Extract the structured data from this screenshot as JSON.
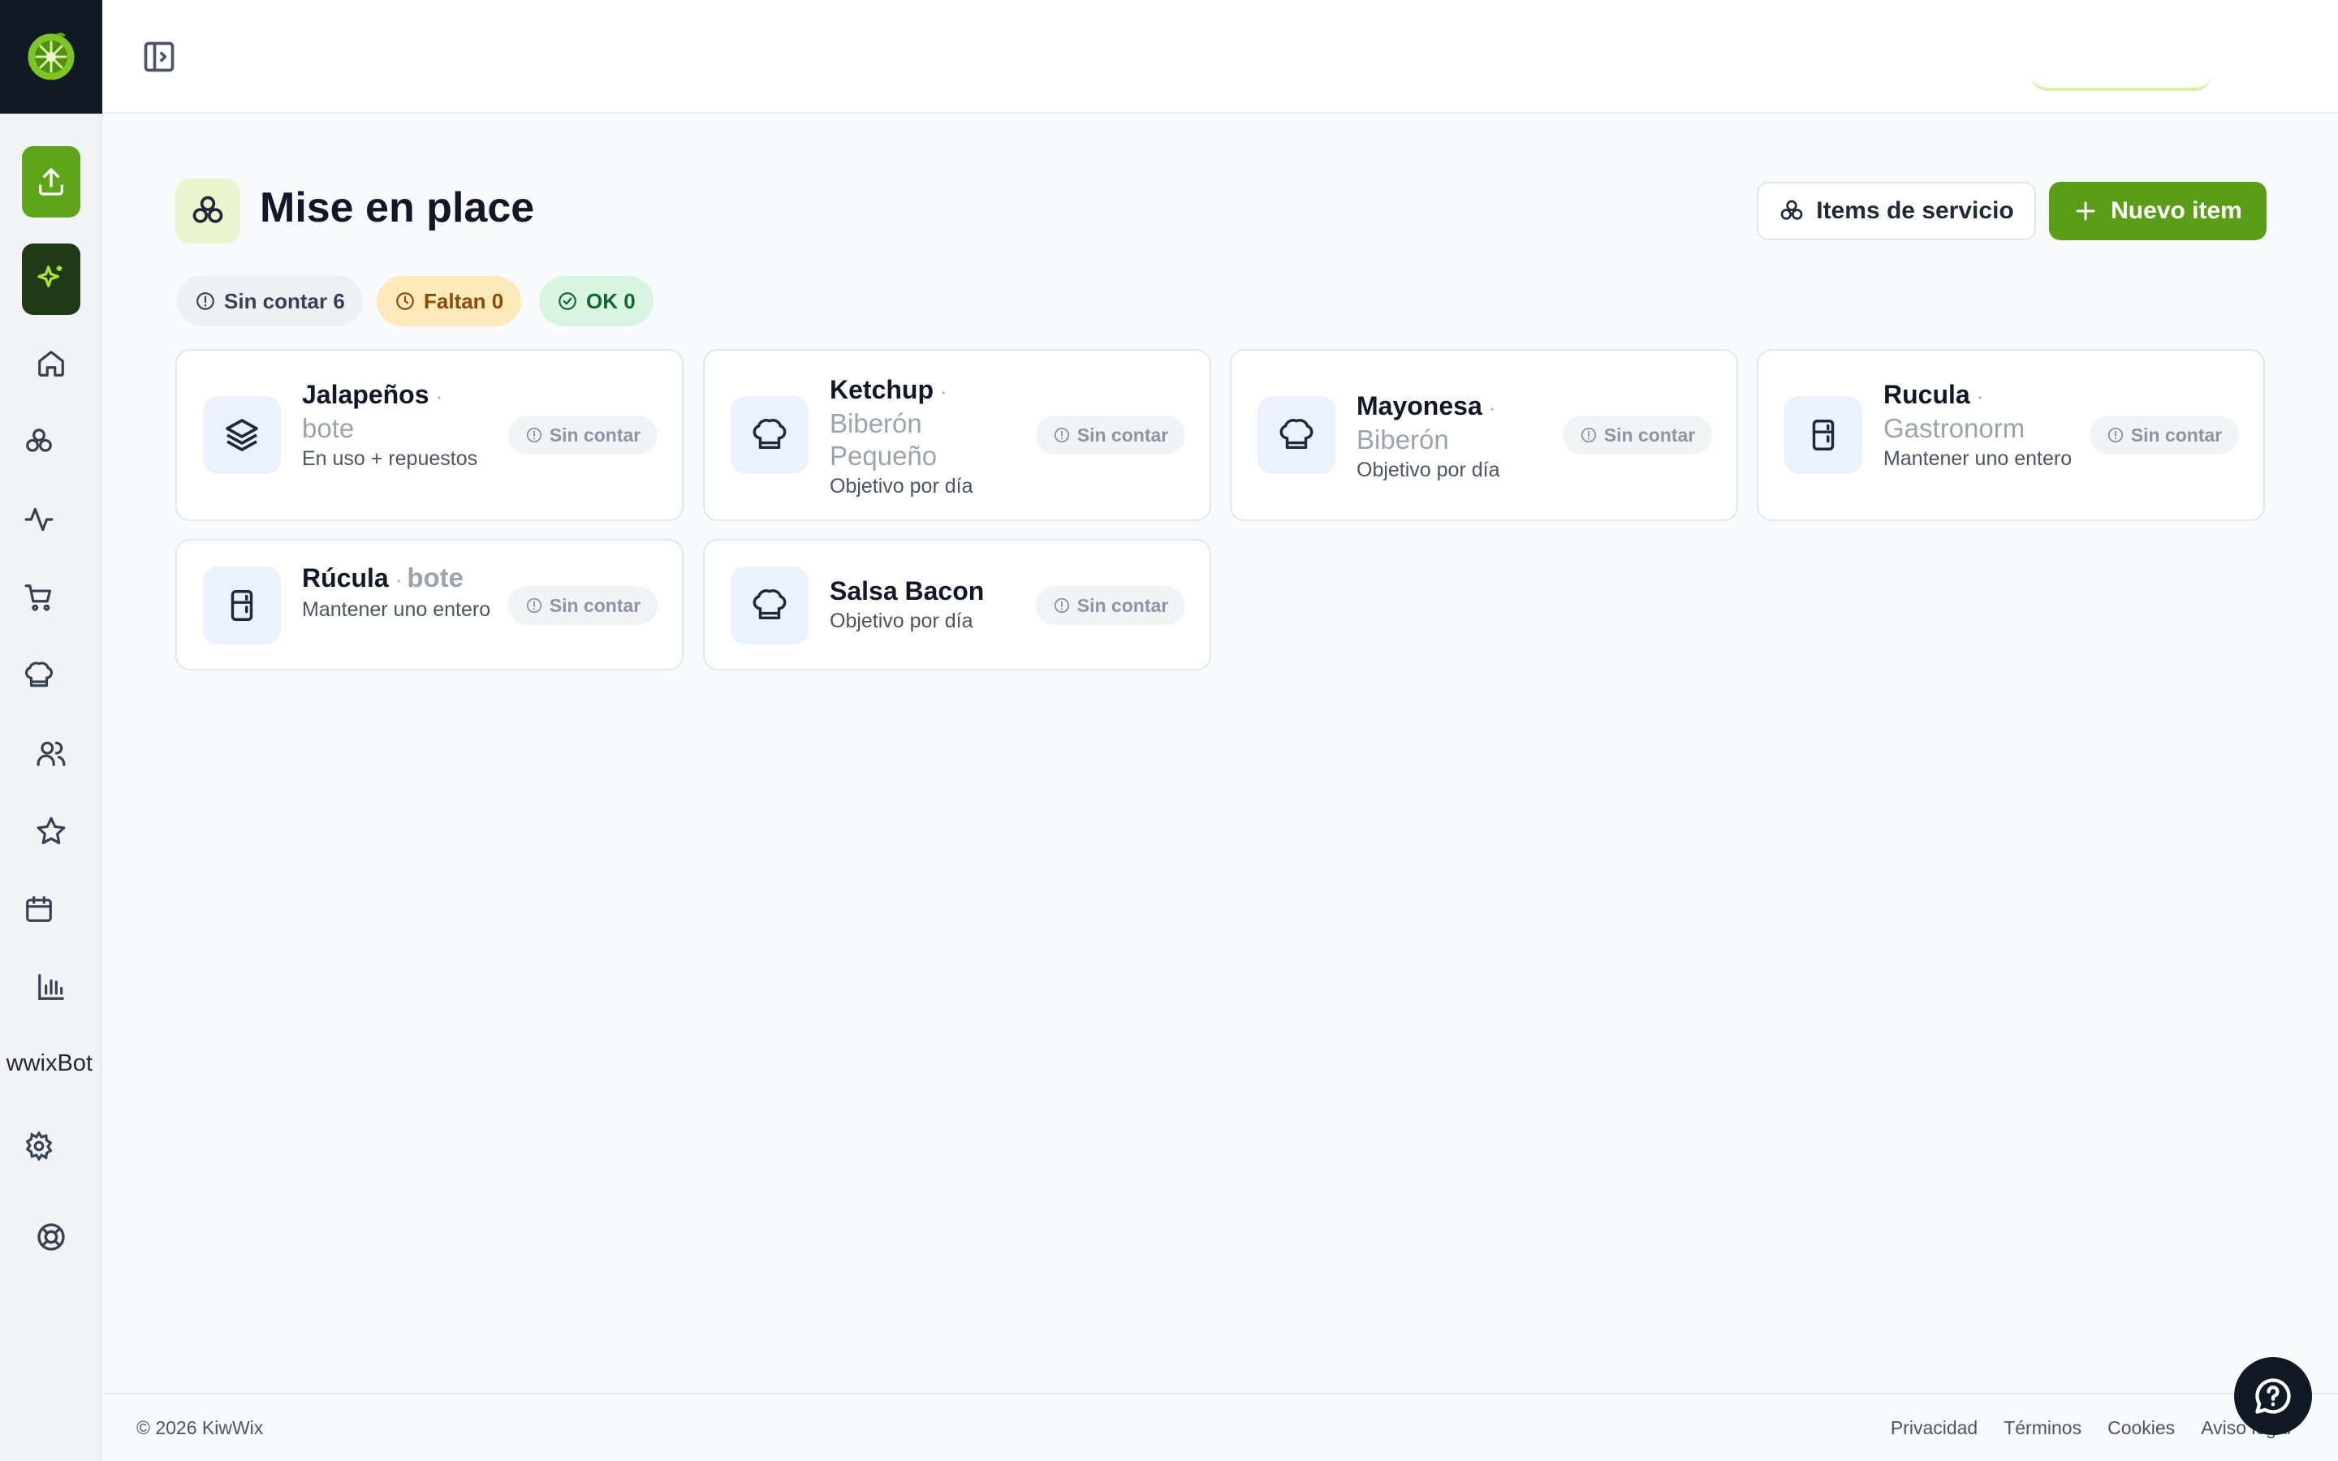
{
  "sidebar": {
    "logo": "kiwwix-logo",
    "bot_label": "wwixBot",
    "items": [
      {
        "icon": "upload-icon"
      },
      {
        "icon": "sparkles-icon"
      },
      {
        "icon": "home-icon"
      },
      {
        "icon": "mise-en-place-icon"
      },
      {
        "icon": "activity-icon"
      },
      {
        "icon": "cart-icon"
      },
      {
        "icon": "chef-hat-icon"
      },
      {
        "icon": "users-icon"
      },
      {
        "icon": "star-icon"
      },
      {
        "icon": "calendar-icon"
      },
      {
        "icon": "bar-chart-icon"
      },
      {
        "icon": "settings-icon"
      },
      {
        "icon": "lifebuoy-icon"
      }
    ]
  },
  "page": {
    "title": "Mise en place",
    "service_items_label": "Items de servicio",
    "new_item_label": "Nuevo item"
  },
  "filters": {
    "uncounted": "Sin contar 6",
    "missing": "Faltan 0",
    "ok": "OK 0"
  },
  "items": [
    {
      "name": "Jalapeños",
      "unit": "bote",
      "desc": "En uso + repuestos",
      "status": "Sin contar",
      "icon": "layers-icon"
    },
    {
      "name": "Ketchup",
      "unit": "Biberón Pequeño",
      "desc": "Objetivo por día",
      "status": "Sin contar",
      "icon": "chef-hat-icon"
    },
    {
      "name": "Mayonesa",
      "unit": "Biberón",
      "desc": "Objetivo por día",
      "status": "Sin contar",
      "icon": "chef-hat-icon"
    },
    {
      "name": "Rucula",
      "unit": "Gastronorm",
      "desc": "Mantener uno entero",
      "status": "Sin contar",
      "icon": "fridge-icon"
    },
    {
      "name": "Rúcula",
      "unit": "bote",
      "desc": "Mantener uno entero",
      "status": "Sin contar",
      "icon": "fridge-icon"
    },
    {
      "name": "Salsa Bacon",
      "unit": "",
      "desc": "Objetivo por día",
      "status": "Sin contar",
      "icon": "chef-hat-icon"
    }
  ],
  "footer": {
    "copyright": "© 2026 KiwWix",
    "links": [
      "Privacidad",
      "Términos",
      "Cookies",
      "Aviso legal"
    ]
  },
  "colors": {
    "brand_green": "#5a9e17",
    "sidebar_dark": "#0f1a24",
    "amber_chip": "#fde9b9",
    "green_chip": "#d7f5df"
  }
}
